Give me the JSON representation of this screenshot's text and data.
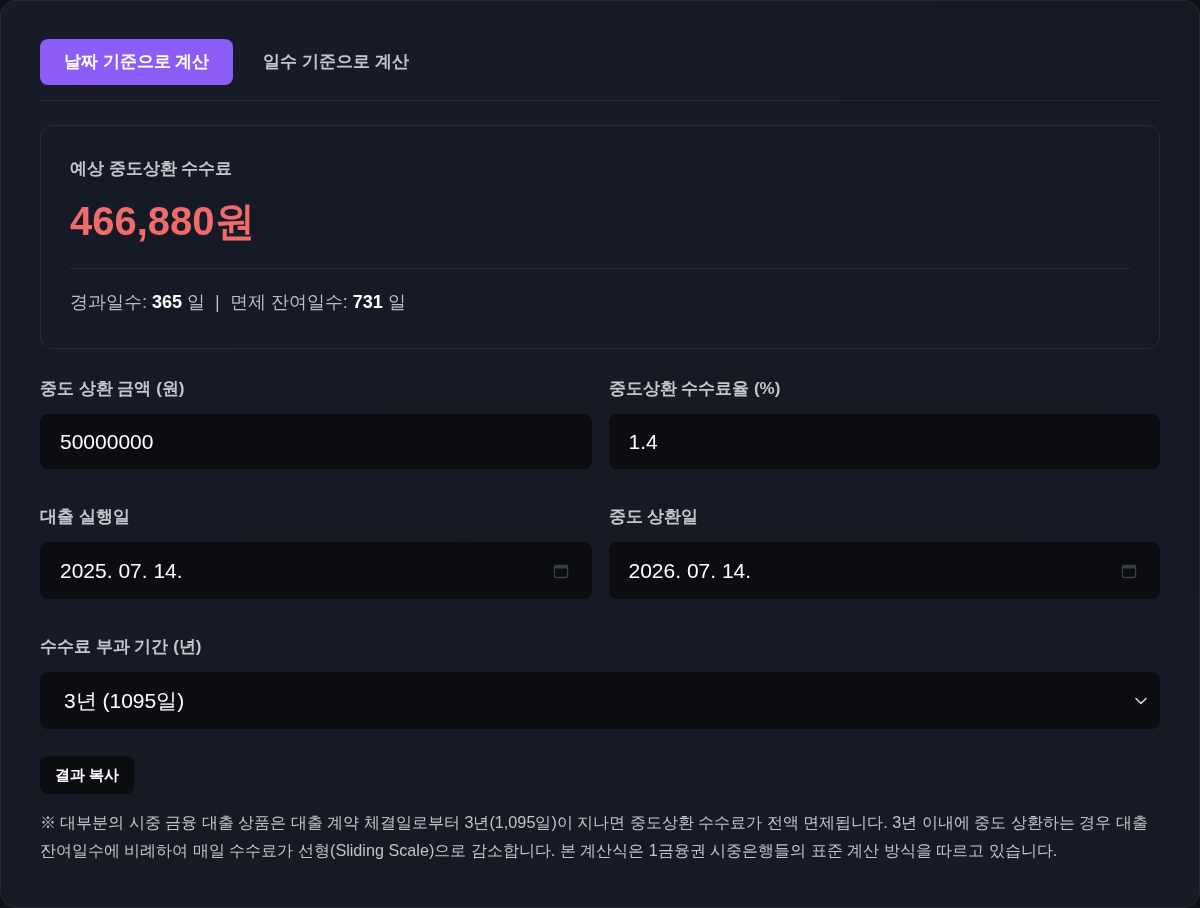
{
  "tabs": [
    {
      "label": "날짜 기준으로 계산",
      "selected": true
    },
    {
      "label": "일수 기준으로 계산",
      "selected": false
    }
  ],
  "result": {
    "label": "예상 중도상환 수수료",
    "amount": "466,880원",
    "summary": "경과일수: **365** 일  |  면제 잔여일수: **731** 일"
  },
  "fields": [
    {
      "kind": "text",
      "label": "중도 상환 금액 (원)",
      "value": "50000000"
    },
    {
      "kind": "text",
      "label": "중도상환 수수료율 (%)",
      "value": "1.4"
    },
    {
      "kind": "date",
      "label": "대출 실행일",
      "value": "2025. 07. 14."
    },
    {
      "kind": "date",
      "label": "중도 상환일",
      "value": "2026. 07. 14."
    },
    {
      "kind": "select",
      "label": "수수료 부과 기간 (년)",
      "value": "3년 (1095일)"
    }
  ],
  "copy_button": "결과 복사",
  "note": "※ 대부분의 시중 금융 대출 상품은 대출 계약 체결일로부터 3년(1,095일)이 지나면 중도상환 수수료가 전액 면제됩니다. 3년 이내에 중도 상환하는 경우 대출 잔여일수에 비례하여 매일 수수료가 선형(Sliding Scale)으로 감소합니다. 본 계산식은 1금융권 시중은행들의 표준 계산 방식을 따르고 있습니다."
}
